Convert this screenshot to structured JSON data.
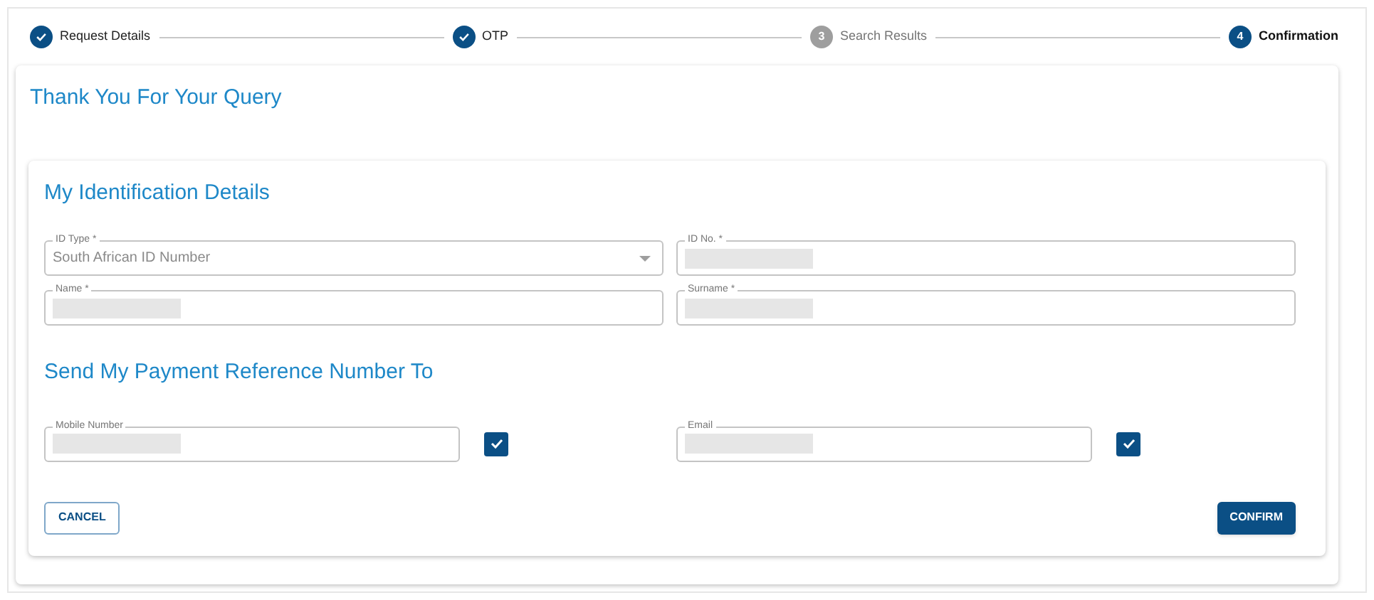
{
  "stepper": [
    {
      "label": "Request Details",
      "completed": true,
      "selected": false
    },
    {
      "label": "OTP",
      "completed": true,
      "selected": false
    },
    {
      "label": "Search Results",
      "number": "3",
      "completed": false,
      "selected": false
    },
    {
      "label": "Confirmation",
      "number": "4",
      "completed": false,
      "selected": true
    }
  ],
  "title": "Thank You For Your Query",
  "identification": {
    "heading": "My Identification Details",
    "fields": [
      {
        "label": "ID Type *",
        "kind": "select",
        "value": "South African ID Number"
      },
      {
        "label": "ID No. *",
        "kind": "text",
        "redacted": true
      },
      {
        "label": "Name *",
        "kind": "text",
        "redacted": true
      },
      {
        "label": "Surname *",
        "kind": "text",
        "redacted": true
      }
    ]
  },
  "send_to": {
    "heading": "Send My Payment Reference Number To",
    "options": [
      {
        "label": "Mobile Number",
        "redacted": true,
        "checked": true
      },
      {
        "label": "Email",
        "redacted": true,
        "checked": true
      }
    ]
  },
  "buttons": [
    {
      "label": "CANCEL",
      "kind": "outline"
    },
    {
      "label": "CONFIRM",
      "kind": "primary"
    }
  ]
}
